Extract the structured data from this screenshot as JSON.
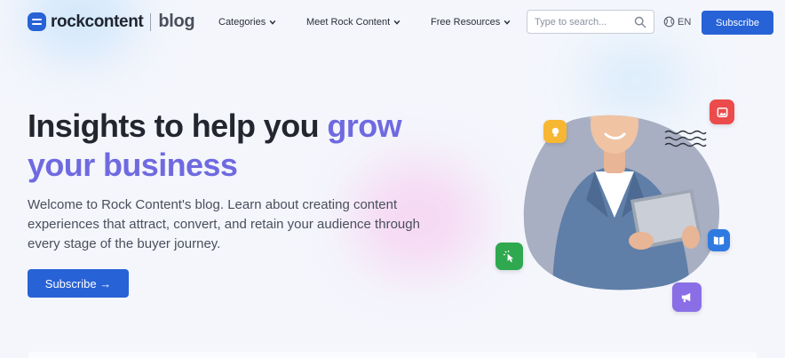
{
  "brand": {
    "name": "rockcontent",
    "section": "blog"
  },
  "nav": {
    "items": [
      {
        "label": "Categories"
      },
      {
        "label": "Meet Rock Content"
      },
      {
        "label": "Free Resources"
      }
    ]
  },
  "search": {
    "placeholder": "Type to search...",
    "value": ""
  },
  "language": {
    "label": "EN"
  },
  "header_cta": {
    "label": "Subscribe"
  },
  "hero": {
    "title_plain": "Insights to help you ",
    "title_accent_1": "grow",
    "title_accent_2": "your business",
    "description": "Welcome to Rock Content's blog. Learn about creating content experiences that attract, convert, and retain your audience through every stage of the buyer journey.",
    "cta_label": "Subscribe →"
  },
  "colors": {
    "primary": "#2762d6",
    "accent": "#6f6ae0",
    "page_bg": "#f4f6fc"
  },
  "icons": [
    "logo-icon",
    "chevron-down-icon",
    "search-icon",
    "globe-icon",
    "lightbulb-icon",
    "image-icon",
    "cursor-click-icon",
    "book-icon",
    "megaphone-icon",
    "waves-icon"
  ]
}
